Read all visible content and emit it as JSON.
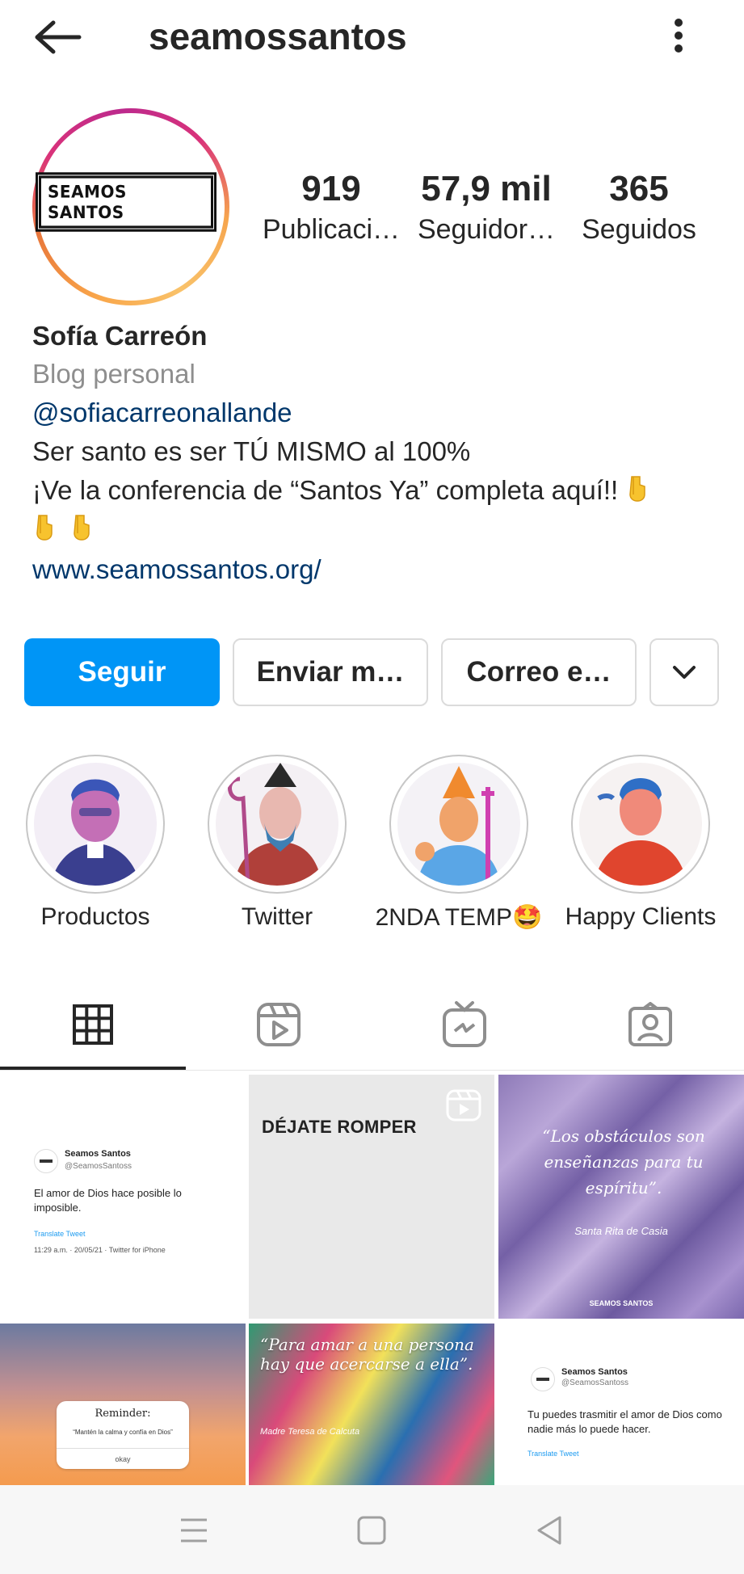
{
  "header": {
    "username": "seamossantos"
  },
  "profile": {
    "avatar_text": "SEAMOS SANTOS",
    "stats": [
      {
        "value": "919",
        "label": "Publicaci…"
      },
      {
        "value": "57,9 mil",
        "label": "Seguidor…"
      },
      {
        "value": "365",
        "label": "Seguidos"
      }
    ],
    "name": "Sofía Carreón",
    "category": "Blog personal",
    "mention": "@sofiacarreonallande",
    "bio_line1": "Ser santo es ser TÚ MISMO al 100%",
    "bio_line2": "¡Ve la conferencia de “Santos Ya” completa aquí!!",
    "website": "www.seamossantos.org/"
  },
  "actions": {
    "follow": "Seguir",
    "message": "Enviar m…",
    "email": "Correo e…"
  },
  "highlights": [
    {
      "label": "Productos"
    },
    {
      "label": "Twitter"
    },
    {
      "label": "2NDA TEMP🤩"
    },
    {
      "label": "Happy Clients"
    }
  ],
  "posts": {
    "p1": {
      "name": "Seamos Santos",
      "handle": "@SeamosSantoss",
      "text": "El amor de Dios hace posible lo imposible.",
      "translate": "Translate Tweet",
      "meta": "11:29 a.m. · 20/05/21 · Twitter for iPhone"
    },
    "p2": {
      "text": "DÉJATE ROMPER"
    },
    "p3": {
      "quote": "“Los obstáculos son enseñanzas para tu espíritu”.",
      "author": "Santa Rita de Casia",
      "brand": "SEAMOS SANTOS"
    },
    "p4": {
      "title": "Reminder:",
      "text": "“Mantén la calma y confía en Dios”",
      "button": "okay"
    },
    "p5": {
      "quote": "“Para amar a una persona hay que acercarse a ella”.",
      "author": "Madre Teresa de Calcuta"
    },
    "p6": {
      "name": "Seamos Santos",
      "handle": "@SeamosSantoss",
      "text": "Tu puedes trasmitir el amor de Dios como nadie más lo puede hacer.",
      "translate": "Translate Tweet"
    }
  },
  "colors": {
    "primary_button": "#0095f6",
    "link": "#00376b",
    "muted": "#8e8e8e",
    "text": "#262626"
  }
}
